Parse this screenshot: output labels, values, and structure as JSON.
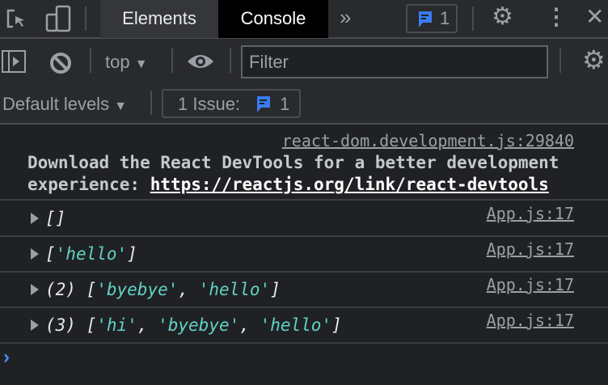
{
  "tabs": {
    "elements": "Elements",
    "console": "Console"
  },
  "issues_badge": "1",
  "toolbar": {
    "context": "top",
    "filter_placeholder": "Filter",
    "levels": "Default levels",
    "issues_label": "1 Issue:",
    "issues_count": "1"
  },
  "messages": [
    {
      "source": "react-dom.development.js:29840",
      "line1": "Download the React DevTools for a better development",
      "line2_prefix": "experience: ",
      "link": "https://reactjs.org/link/react-devtools"
    }
  ],
  "logs": [
    {
      "source": "App.js:17",
      "count": "",
      "items": []
    },
    {
      "source": "App.js:17",
      "count": "",
      "items": [
        "'hello'"
      ]
    },
    {
      "source": "App.js:17",
      "count": "(2)",
      "items": [
        "'byebye'",
        "'hello'"
      ]
    },
    {
      "source": "App.js:17",
      "count": "(3)",
      "items": [
        "'hi'",
        "'byebye'",
        "'hello'"
      ]
    }
  ],
  "colors": {
    "string": "#5fd3c4",
    "prompt": "#4d8af0",
    "badge": "#3a7bf0"
  }
}
